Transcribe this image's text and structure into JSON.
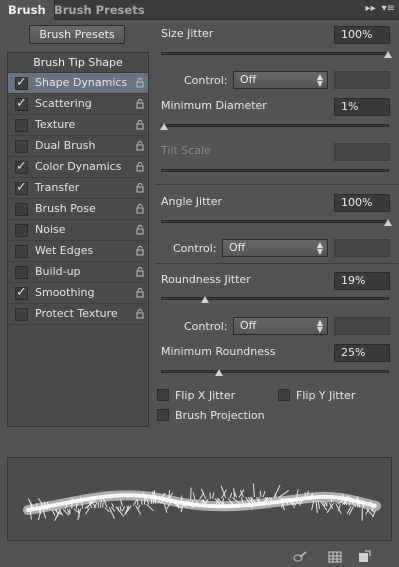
{
  "tabs": [
    {
      "label": "Brush"
    },
    {
      "label": "Brush Presets"
    }
  ],
  "brush_presets_button": "Brush Presets",
  "brush_tip_shape": "Brush Tip Shape",
  "options": [
    {
      "label": "Shape Dynamics",
      "checked": true,
      "selected": true
    },
    {
      "label": "Scattering",
      "checked": true
    },
    {
      "label": "Texture",
      "checked": false
    },
    {
      "label": "Dual Brush",
      "checked": false
    },
    {
      "label": "Color Dynamics",
      "checked": true
    },
    {
      "label": "Transfer",
      "checked": true
    },
    {
      "label": "Brush Pose",
      "checked": false
    },
    {
      "label": "Noise",
      "checked": false
    },
    {
      "label": "Wet Edges",
      "checked": false
    },
    {
      "label": "Build-up",
      "checked": false
    },
    {
      "label": "Smoothing",
      "checked": true
    },
    {
      "label": "Protect Texture",
      "checked": false
    }
  ],
  "size_jitter": {
    "label": "Size Jitter",
    "value": "100%",
    "percent": 100
  },
  "control1": {
    "label": "Control:",
    "value": "Off"
  },
  "min_diameter": {
    "label": "Minimum Diameter",
    "value": "1%",
    "percent": 1
  },
  "tilt_scale": {
    "label": "Tilt Scale"
  },
  "angle_jitter": {
    "label": "Angle Jitter",
    "value": "100%",
    "percent": 100
  },
  "control2": {
    "label": "Control:",
    "value": "Off"
  },
  "roundness_jitter": {
    "label": "Roundness Jitter",
    "value": "19%",
    "percent": 19
  },
  "control3": {
    "label": "Control:",
    "value": "Off"
  },
  "min_roundness": {
    "label": "Minimum Roundness",
    "value": "25%",
    "percent": 25
  },
  "flip_x": {
    "label": "Flip X Jitter",
    "checked": false
  },
  "flip_y": {
    "label": "Flip Y Jitter",
    "checked": false
  },
  "brush_projection": {
    "label": "Brush Projection",
    "checked": false
  },
  "icons": {
    "panel_menu": "panel-menu-icon",
    "collapse": "collapse-arrows-icon",
    "toggle_live_tip": "live-tip-icon",
    "grid": "grid-icon",
    "new_preset": "new-preset-icon"
  }
}
